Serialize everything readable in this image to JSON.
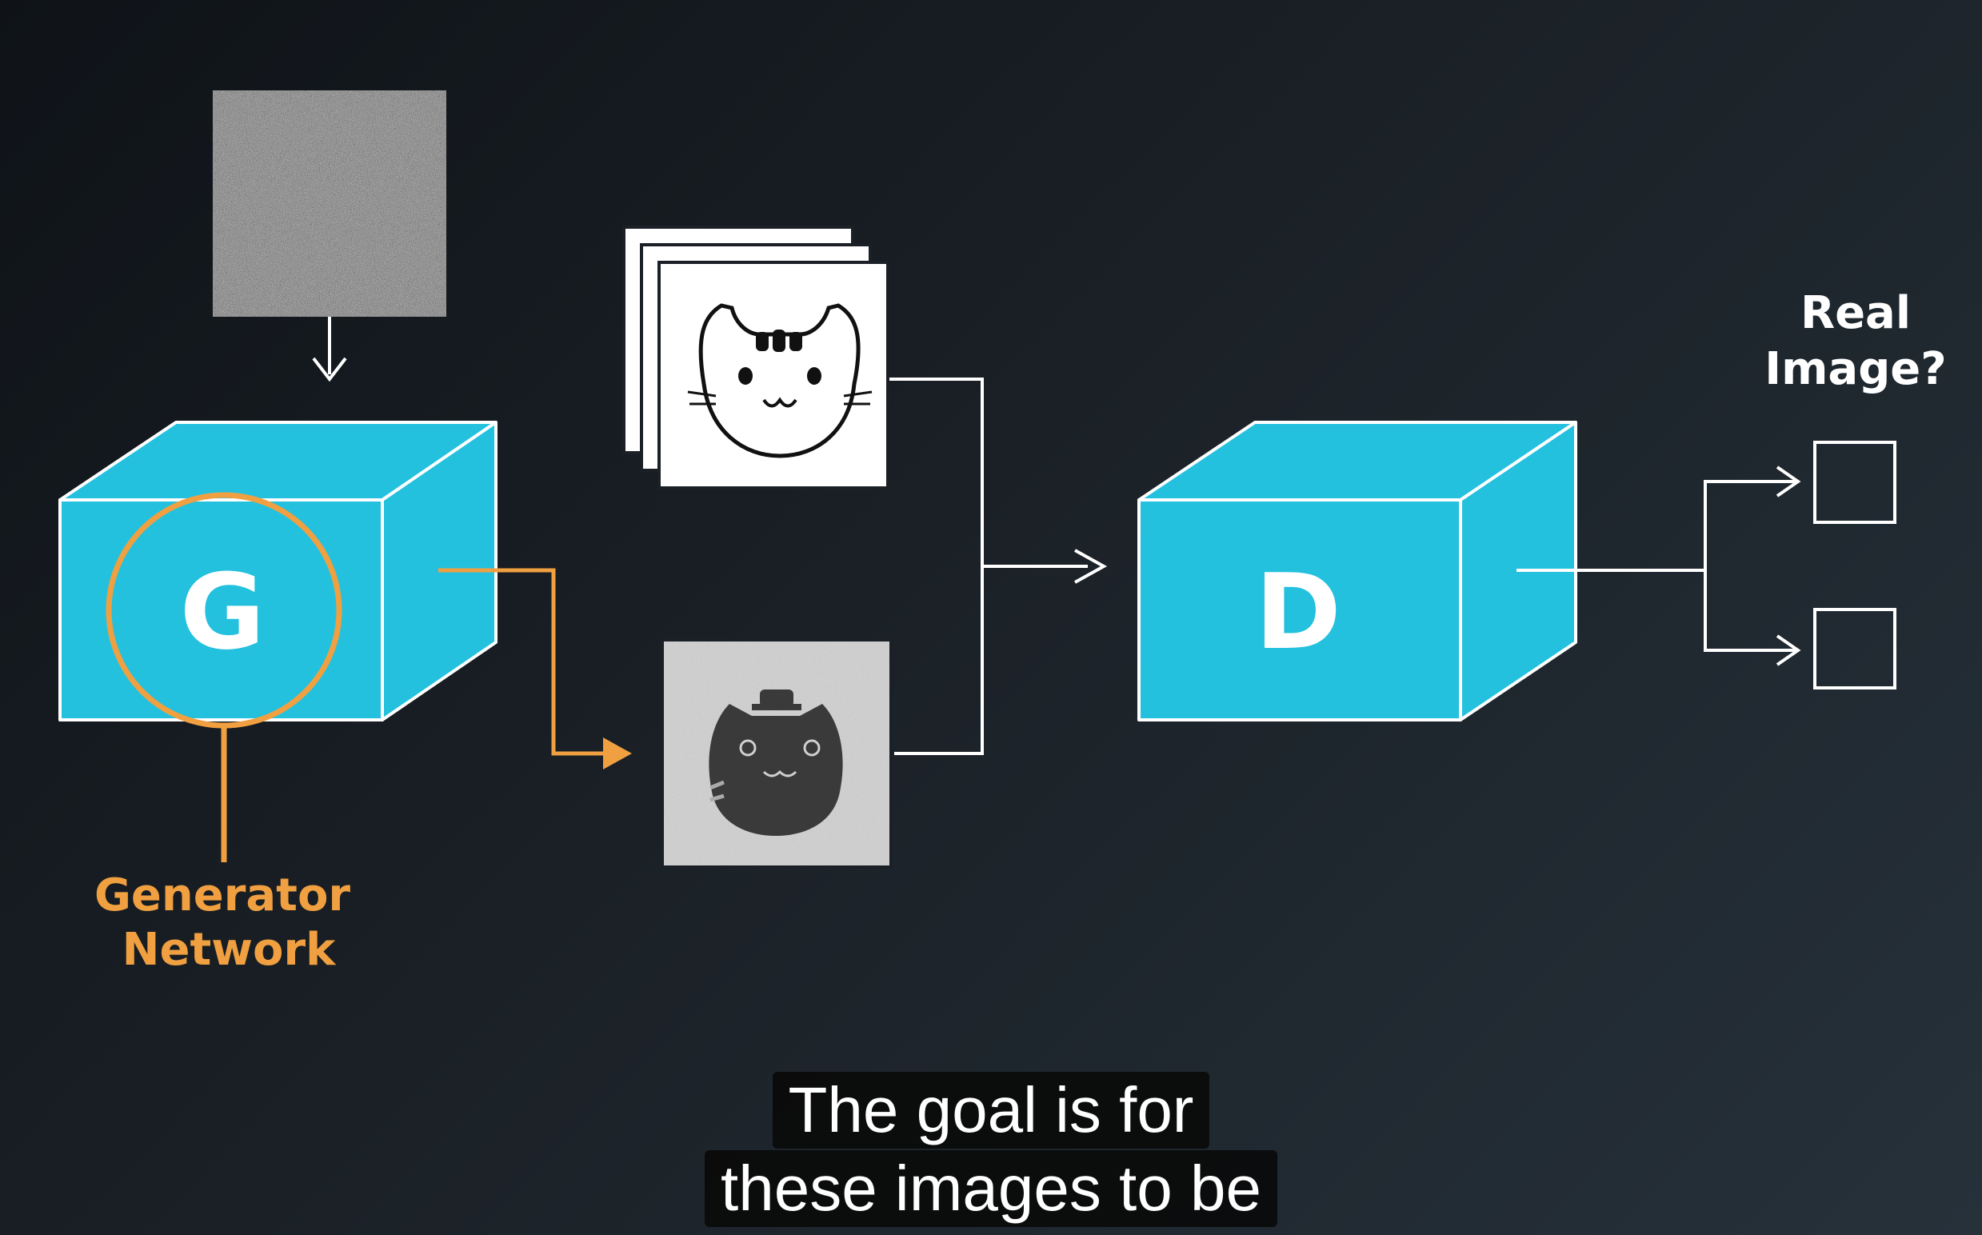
{
  "generator": {
    "letter": "G",
    "label_line1": "Generator",
    "label_line2": "Network"
  },
  "discriminator": {
    "letter": "D"
  },
  "output": {
    "question_line1": "Real",
    "question_line2": "Image?"
  },
  "caption": {
    "line1": "The goal is for",
    "line2": "these images to be"
  },
  "colors": {
    "box_fill": "#24c1de",
    "generator_accent": "#f0a040",
    "line": "#ffffff",
    "background": "#1a2026"
  },
  "icons": {
    "noise_input": "noise-image-icon",
    "real_images": "cat-drawing-stack-icon",
    "fake_image": "generated-cat-icon"
  }
}
